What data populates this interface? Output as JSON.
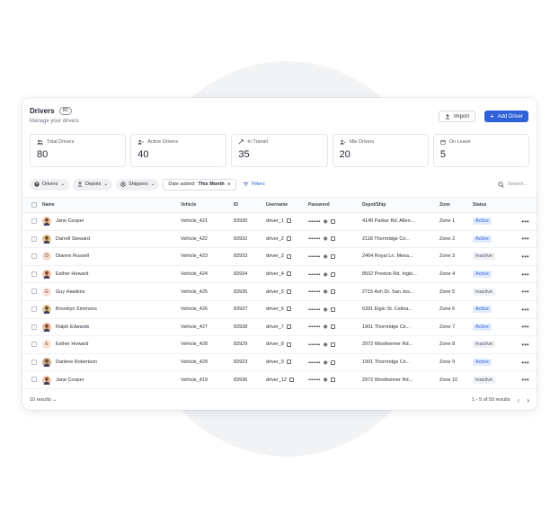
{
  "header": {
    "title": "Drivers",
    "count": "80",
    "subtitle": "Manage your drivers",
    "import_label": "Import",
    "add_label": "Add Driver"
  },
  "stats": [
    {
      "label": "Total Drivers",
      "value": "80",
      "icon": "users-icon"
    },
    {
      "label": "Active Drivers",
      "value": "40",
      "icon": "user-check-icon"
    },
    {
      "label": "In Transit",
      "value": "35",
      "icon": "route-icon"
    },
    {
      "label": "Idle Drivers",
      "value": "20",
      "icon": "user-idle-icon"
    },
    {
      "label": "On Leave",
      "value": "5",
      "icon": "calendar-icon"
    }
  ],
  "filters": {
    "drivers": "Drivers",
    "depots": "Depots",
    "shippers": "Shippers",
    "date_prefix": "Date added:",
    "date_value": "This Month",
    "filters_label": "Filters",
    "search_placeholder": "Search..."
  },
  "table": {
    "columns": [
      "Name",
      "Vehicle",
      "ID",
      "Username",
      "Password",
      "Depot/Ship",
      "Zone",
      "Status"
    ],
    "rows": [
      {
        "name": "Jane Cooper",
        "vehicle": "Vehicle_421",
        "id": "83930",
        "username": "driver_1",
        "password": "•••••••",
        "depot": "4140 Parker Rd. Allen...",
        "zone": "Zone 1",
        "status": "Active",
        "avatar": "photo"
      },
      {
        "name": "Darrell Steward",
        "vehicle": "Vehicle_422",
        "id": "83932",
        "username": "driver_2",
        "password": "•••••••",
        "depot": "2118 Thornridge Cir...",
        "zone": "Zone 2",
        "status": "Active",
        "avatar": "photo"
      },
      {
        "name": "Dianne Russell",
        "vehicle": "Vehicle_423",
        "id": "83933",
        "username": "driver_3",
        "password": "•••••••",
        "depot": "2464 Royal Ln. Mesa...",
        "zone": "Zone 3",
        "status": "Inactive",
        "avatar": "D"
      },
      {
        "name": "Esther Howard",
        "vehicle": "Vehicle_424",
        "id": "83934",
        "username": "driver_4",
        "password": "•••••••",
        "depot": "8502 Preston Rd. Ingle...",
        "zone": "Zone 4",
        "status": "Active",
        "avatar": "photo"
      },
      {
        "name": "Guy Hawkins",
        "vehicle": "Vehicle_425",
        "id": "83935",
        "username": "driver_5",
        "password": "•••••••",
        "depot": "2715 Ash Dr. San Jos...",
        "zone": "Zone 5",
        "status": "Inactive",
        "avatar": "G"
      },
      {
        "name": "Brooklyn Simmons",
        "vehicle": "Vehicle_426",
        "id": "83937",
        "username": "driver_6",
        "password": "•••••••",
        "depot": "6391 Elgin St. Celina...",
        "zone": "Zone 6",
        "status": "Active",
        "avatar": "photo"
      },
      {
        "name": "Ralph Edwards",
        "vehicle": "Vehicle_427",
        "id": "83938",
        "username": "driver_7",
        "password": "•••••••",
        "depot": "1901 Thornridge Cir...",
        "zone": "Zone 7",
        "status": "Active",
        "avatar": "photo"
      },
      {
        "name": "Esther Howard",
        "vehicle": "Vehicle_428",
        "id": "83929",
        "username": "driver_8",
        "password": "•••••••",
        "depot": "2972 Westheimer Rd...",
        "zone": "Zone 8",
        "status": "Inactive",
        "avatar": "E"
      },
      {
        "name": "Darlene Robertson",
        "vehicle": "Vehicle_429",
        "id": "83923",
        "username": "driver_9",
        "password": "•••••••",
        "depot": "1901 Thornridge Cir...",
        "zone": "Zone 9",
        "status": "Active",
        "avatar": "photo"
      },
      {
        "name": "Jane Cooper",
        "vehicle": "Vehicle_419",
        "id": "83936",
        "username": "driver_12",
        "password": "•••••••",
        "depot": "2972 Westheimer Rd...",
        "zone": "Zone 10",
        "status": "Inactive",
        "avatar": "photo"
      }
    ]
  },
  "footer": {
    "results": "10 results",
    "range": "1 - 5 of 50 results"
  },
  "colors": {
    "accent": "#2f62d7",
    "active_bg": "#e1ebff",
    "inactive_bg": "#eef0f3"
  }
}
